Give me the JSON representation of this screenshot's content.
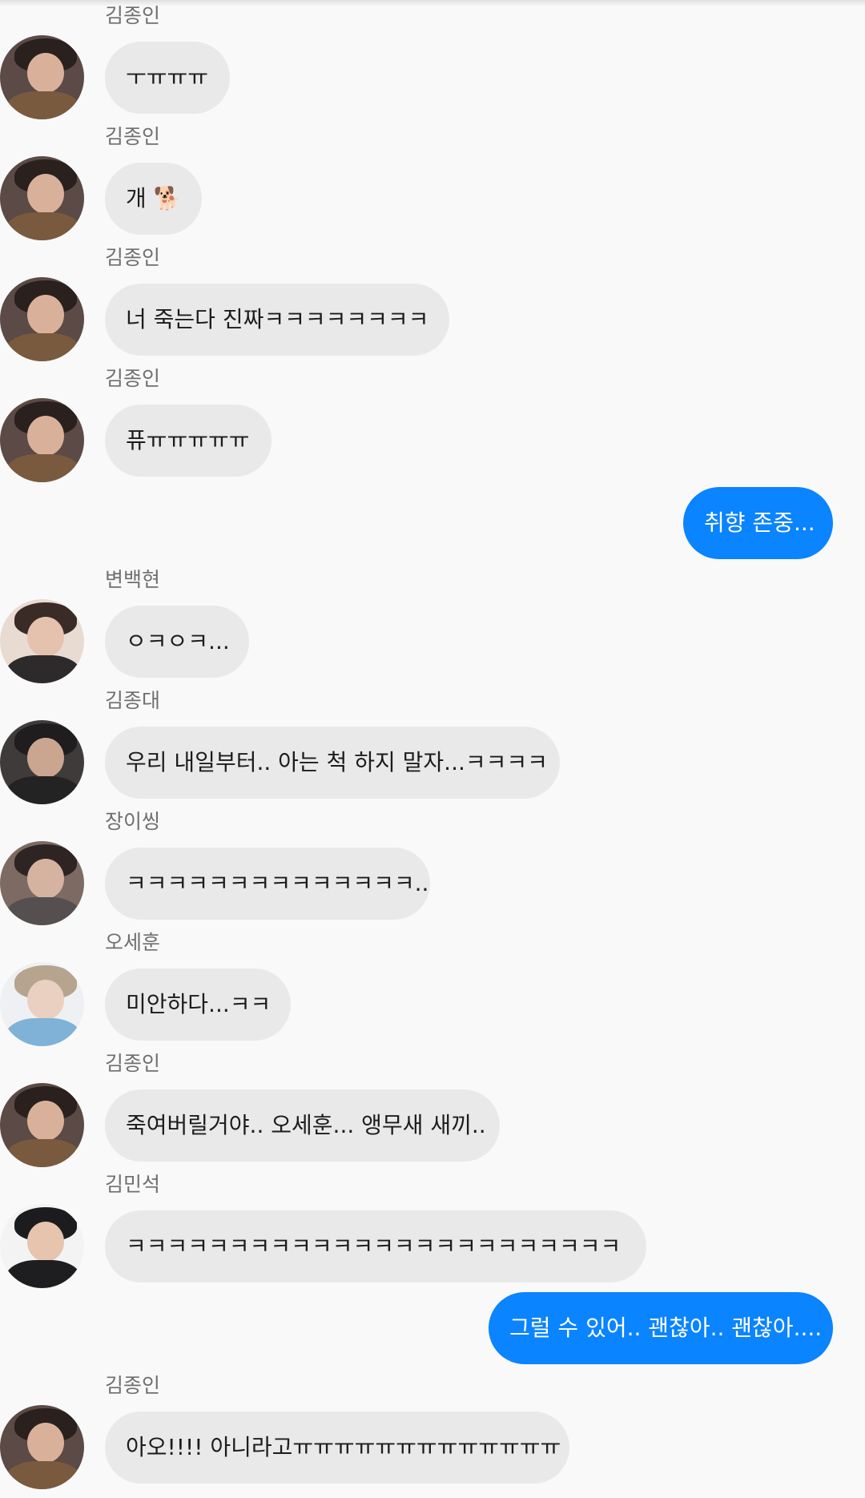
{
  "messages": [
    {
      "sender": "김종인",
      "text": "ㅜㅠㅠㅠ"
    },
    {
      "sender": "김종인",
      "text": "개 🐕"
    },
    {
      "sender": "김종인",
      "text": "너 죽는다 진짜ㅋㅋㅋㅋㅋㅋㅋㅋ"
    },
    {
      "sender": "김종인",
      "text": "퓨ㅠㅠㅠㅠㅠ"
    },
    {
      "sender": "",
      "text": "취향 존중..."
    },
    {
      "sender": "변백현",
      "text": "ㅇㅋㅇㅋ..."
    },
    {
      "sender": "김종대",
      "text": "우리 내일부터.. 아는 척 하지 말자...ㅋㅋㅋㅋ"
    },
    {
      "sender": "장이씽",
      "text": "ㅋㅋㅋㅋㅋㅋㅋㅋㅋㅋㅋㅋㅋㅋ.."
    },
    {
      "sender": "오세훈",
      "text": "미안하다...ㅋㅋ"
    },
    {
      "sender": "김종인",
      "text": "죽여버릴거야.. 오세훈... 앵무새 새끼.."
    },
    {
      "sender": "김민석",
      "text": "ㅋㅋㅋㅋㅋㅋㅋㅋㅋㅋㅋㅋㅋㅋㅋㅋㅋㅋㅋㅋㅋㅋㅋㅋ"
    },
    {
      "sender": "",
      "text": "그럴 수 있어.. 괜찮아.. 괜찮아...."
    },
    {
      "sender": "김종인",
      "text": "아오!!!! 아니라고ㅠㅠㅠㅠㅠㅠㅠㅠㅠㅠㅠㅠㅠ"
    }
  ],
  "colors": {
    "background": "#f9f9f9",
    "incoming_bubble": "#e9e9e9",
    "outgoing_bubble": "#0a84ff",
    "sender_name": "#6f6f6f"
  },
  "avatars": {
    "kim-jongin": "avatar-photo",
    "byun-baekhyun": "avatar-photo",
    "kim-jongdae": "avatar-photo",
    "zhang-yixing": "avatar-photo",
    "oh-sehun": "avatar-photo",
    "kim-minseok": "avatar-photo"
  }
}
